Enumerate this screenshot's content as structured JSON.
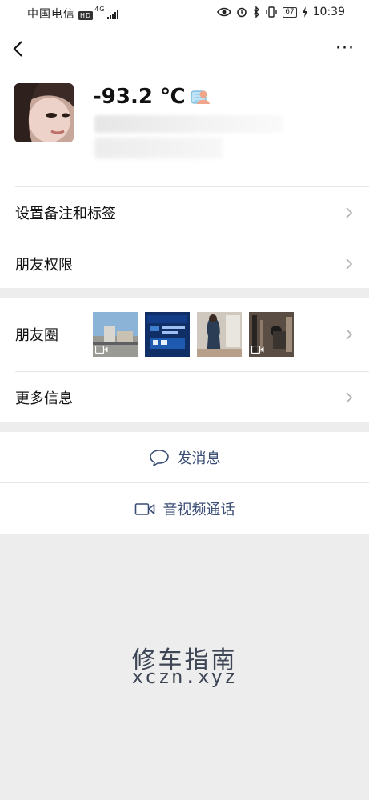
{
  "status_bar": {
    "carrier": "中国电信",
    "hd_badge": "HD",
    "network": "4G",
    "battery": "67",
    "time": "10:39"
  },
  "nav": {
    "back_icon": "chevron-left-icon",
    "more_icon": "more-dots-icon",
    "more_label": "···"
  },
  "profile": {
    "display_name": "-93.2 ℃",
    "status_icon": "ice-cube-icon",
    "gender_icon": "person-icon"
  },
  "settings": {
    "remark_tags": "设置备注和标签",
    "friend_permissions": "朋友权限"
  },
  "moments": {
    "label": "朋友圈",
    "thumbnails": [
      "thumb-1",
      "thumb-2",
      "thumb-3",
      "thumb-4"
    ]
  },
  "more_info": {
    "label": "更多信息"
  },
  "actions": {
    "message": "发消息",
    "video_call": "音视频通话"
  },
  "watermark": {
    "line1": "修车指南",
    "line2": "xczn.xyz"
  },
  "colors": {
    "accent": "#3a4d74",
    "background": "#ededed",
    "panel": "#ffffff"
  }
}
